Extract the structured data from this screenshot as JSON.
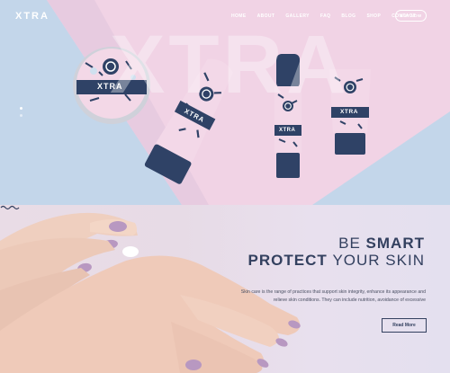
{
  "brand": {
    "logo_text": "XTRA",
    "watermark": "XTRA",
    "tube_label": "XTRA"
  },
  "nav": {
    "items": [
      {
        "label": "HOME"
      },
      {
        "label": "ABOUT"
      },
      {
        "label": "GALLERY"
      },
      {
        "label": "FAQ"
      },
      {
        "label": "BLOG"
      },
      {
        "label": "SHOP"
      },
      {
        "label": "CONTACT"
      }
    ],
    "buy_label": "BUY NOW"
  },
  "section": {
    "heading_light_1": "BE ",
    "heading_bold_1": "SMART",
    "heading_bold_2": "PROTECT ",
    "heading_light_2": "YOUR SKIN",
    "description": "Skin care is the range of practices that support skin integrity, enhance its appearance and relieve skin conditions. They can include nutrition, avoidance of excessive",
    "read_more": "Read More"
  },
  "colors": {
    "blue": "#c3d6ea",
    "pink": "#f0d3e6",
    "navy": "#2f4266",
    "accent": "#33405f"
  }
}
